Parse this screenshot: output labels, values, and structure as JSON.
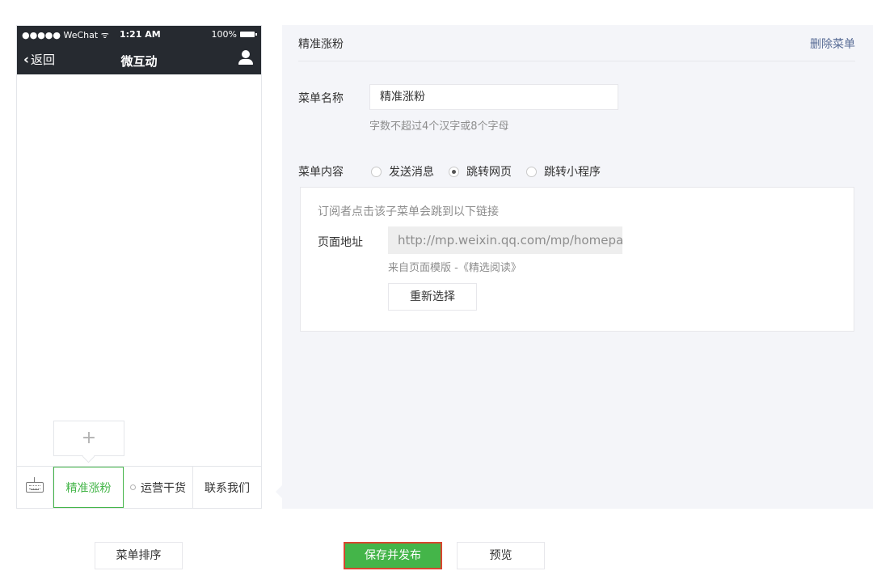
{
  "phone": {
    "status_bar": {
      "carrier": "●●●●● WeChat ᯤ",
      "time": "1:21 AM",
      "battery": "100%"
    },
    "nav": {
      "back_label": "返回",
      "title": "微互动"
    },
    "add_sub_label": "+",
    "menu_items": [
      {
        "label": "精准涨粉",
        "active": true
      },
      {
        "label": "运营干货",
        "active": false
      },
      {
        "label": "联系我们",
        "active": false
      }
    ]
  },
  "editor": {
    "title": "精准涨粉",
    "delete_label": "删除菜单",
    "name_label": "菜单名称",
    "name_value": "精准涨粉",
    "name_tip": "字数不超过4个汉字或8个字母",
    "content_label": "菜单内容",
    "options": [
      {
        "label": "发送消息",
        "checked": false
      },
      {
        "label": "跳转网页",
        "checked": true
      },
      {
        "label": "跳转小程序",
        "checked": false
      }
    ],
    "box": {
      "desc": "订阅者点击该子菜单会跳到以下链接",
      "url_label": "页面地址",
      "url_value": "http://mp.weixin.qq.com/mp/homepage",
      "from_template": "来自页面模版 -《精选阅读》",
      "reselect_label": "重新选择"
    }
  },
  "footer": {
    "sort_label": "菜单排序",
    "save_label": "保存并发布",
    "preview_label": "预览"
  },
  "colors": {
    "accent_green": "#44b549",
    "link_blue": "#576b95",
    "header_dark": "#262a30",
    "highlight_red": "#d9452f"
  }
}
